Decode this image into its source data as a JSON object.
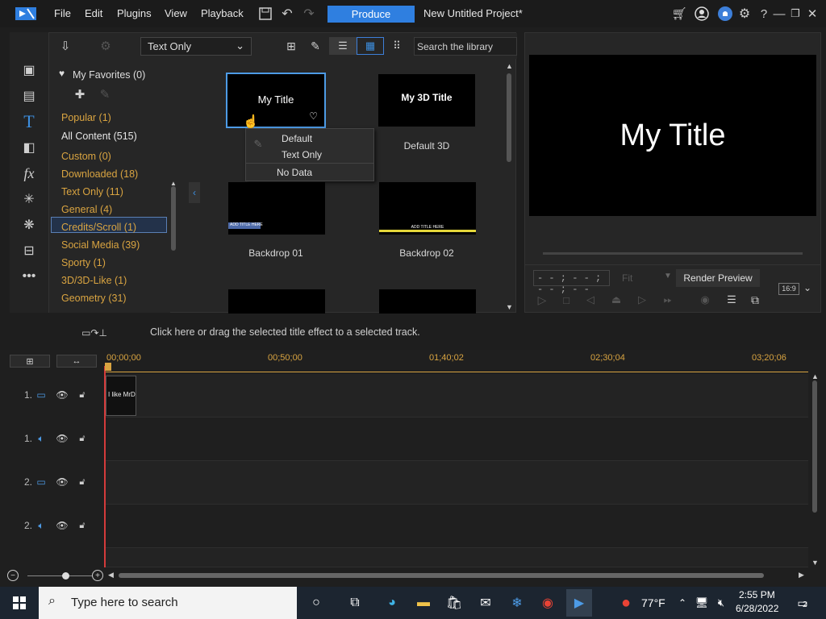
{
  "menu": {
    "file": "File",
    "edit": "Edit",
    "plugins": "Plugins",
    "view": "View",
    "playback": "Playback",
    "produce": "Produce",
    "project_title": "New Untitled Project*"
  },
  "library": {
    "category_select": "Text Only",
    "search_placeholder": "Search the library",
    "favorites": "My Favorites (0)",
    "categories": [
      {
        "label": "Popular (1)",
        "color": "#d9a441"
      },
      {
        "label": "All Content (515)",
        "color": "#e6e6e6"
      },
      {
        "label": "Custom  (0)",
        "color": "#d9a441"
      },
      {
        "label": "Downloaded  (18)",
        "color": "#d9a441"
      },
      {
        "label": "Text Only  (11)",
        "color": "#d9a441",
        "selected": true
      },
      {
        "label": "General  (4)",
        "color": "#d9a441"
      },
      {
        "label": "Credits/Scroll  (1)",
        "color": "#d9a441"
      },
      {
        "label": "Social Media  (39)",
        "color": "#d9a441"
      },
      {
        "label": "Sporty  (1)",
        "color": "#d9a441"
      },
      {
        "label": "3D/3D-Like  (1)",
        "color": "#d9a441"
      },
      {
        "label": "Geometry  (31)",
        "color": "#d9a441"
      }
    ],
    "thumbs": [
      {
        "label": "",
        "caption": "My Title"
      },
      {
        "label": "Default 3D",
        "caption": "My 3D Title"
      },
      {
        "label": "Backdrop 01",
        "caption": "ADD TITLE HERE"
      },
      {
        "label": "Backdrop 02",
        "caption": "ADD TITLE HERE"
      }
    ]
  },
  "context_menu": {
    "items": [
      "Default",
      "Text Only",
      "No Data"
    ]
  },
  "preview": {
    "title_text": "My Title",
    "timecode": "- - ; - - ; - - ; - -",
    "fit": "Fit",
    "render_preview": "Render Preview",
    "aspect": "16:9"
  },
  "hint": "Click here or drag the selected title effect to a selected track.",
  "timeline": {
    "timecodes": [
      "00;00;00",
      "00;50;00",
      "01;40;02",
      "02;30;04",
      "03;20;06"
    ],
    "tracks": [
      {
        "num": "1.",
        "type": "video"
      },
      {
        "num": "1.",
        "type": "audio"
      },
      {
        "num": "2.",
        "type": "video"
      },
      {
        "num": "2.",
        "type": "audio"
      }
    ],
    "clip_text": "I like MrD"
  },
  "taskbar": {
    "search": "Type here to search",
    "weather": "77°F",
    "time": "2:55 PM",
    "date": "6/28/2022",
    "notifications": "2"
  },
  "colors": {
    "accent": "#2f7fe0",
    "category": "#d9a441",
    "playhead": "#d43b3b"
  }
}
